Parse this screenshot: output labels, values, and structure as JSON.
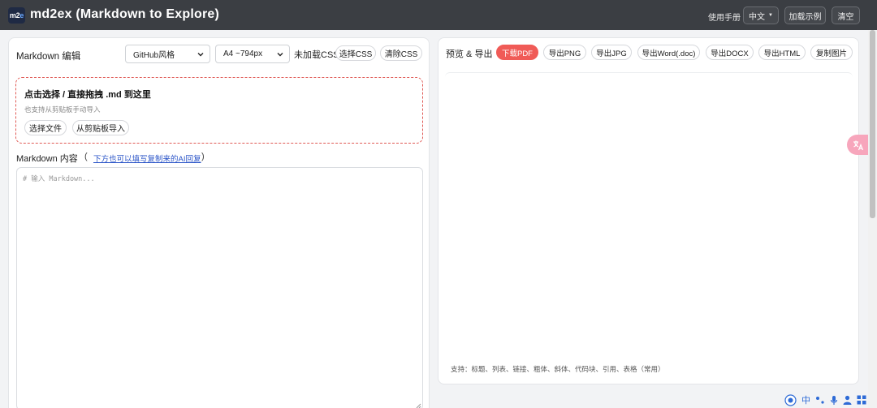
{
  "header": {
    "logo_main": "m2",
    "logo_accent": "e",
    "title": "md2ex (Markdown to Explore)",
    "help_link": "使用手册",
    "language": "中文",
    "load_example": "加载示例",
    "clear": "清空"
  },
  "editor_panel": {
    "title": "Markdown 编辑",
    "theme_select": "GitHub风格",
    "size_select": "A4 ~794px",
    "css_status": "未加载CSS",
    "select_css": "选择CSS",
    "clear_css": "清除CSS",
    "dropzone": {
      "title": "点击选择 / 直接拖拽 .md 到这里",
      "subtitle": "也支持从剪贴板手动导入",
      "choose_file": "选择文件",
      "from_clipboard": "从剪贴板导入"
    },
    "content_label": "Markdown 内容",
    "paren_open": "(",
    "paren_close": ")",
    "hint_link": "下方也可以填写复制来的AI回复",
    "placeholder": "# 输入 Markdown..."
  },
  "preview_panel": {
    "title": "预览 & 导出",
    "buttons": {
      "download_pdf": "下载PDF",
      "export_png": "导出PNG",
      "export_jpg": "导出JPG",
      "export_word": "导出Word(.doc)",
      "export_docx": "导出DOCX",
      "export_html": "导出HTML",
      "copy_image": "复制图片"
    },
    "support_text": "支持：标题、列表、链接、粗体、斜体、代码块、引用、表格（常用）"
  },
  "ime": {
    "lang": "中"
  },
  "colors": {
    "header_bg": "#3b3e43",
    "primary": "#f05b57",
    "dropzone_border": "#e05a55",
    "link": "#2b55c8"
  }
}
